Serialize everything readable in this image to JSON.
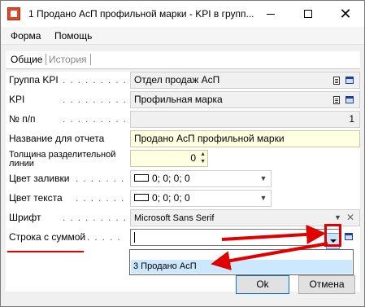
{
  "window": {
    "title": "1 Продано АсП профильной марки - KPI в групп..."
  },
  "menu": {
    "forma": "Форма",
    "help": "Помощь"
  },
  "tabs": {
    "general": "Общие",
    "history": "История"
  },
  "fields": {
    "group_label": "Группа KPI",
    "group_value": "Отдел продаж АсП",
    "kpi_label": "KPI",
    "kpi_value": "Профильная марка",
    "num_label": "№ п/п",
    "num_value": "1",
    "report_label": "Название для отчета",
    "report_value": "Продано АсП профильной марки",
    "thickness_label_1": "Толщина разделительной",
    "thickness_label_2": "линии",
    "thickness_value": "0",
    "fill_label": "Цвет заливки",
    "fill_value": "0; 0; 0; 0",
    "text_color_label": "Цвет текста",
    "text_color_value": "0; 0; 0; 0",
    "font_label": "Шрифт",
    "font_value": "Microsoft Sans Serif",
    "sum_row_label": "Строка с суммой",
    "sum_row_value": ""
  },
  "dropdown": {
    "option": "3 Продано АсП"
  },
  "buttons": {
    "ok": "Ok",
    "cancel": "Отмена"
  },
  "colors": {
    "highlight": "#e00000",
    "selection": "#cce8ff",
    "required_field": "#ffffe1"
  }
}
